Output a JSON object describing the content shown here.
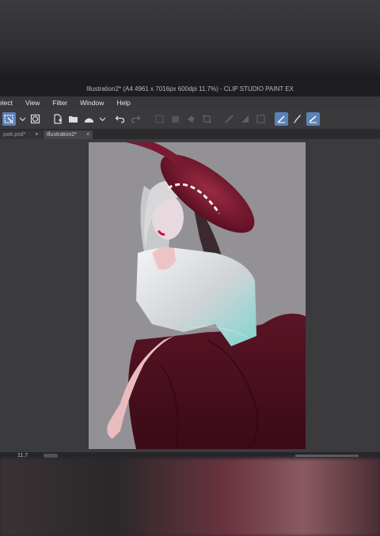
{
  "window": {
    "title": "Illustration2* (A4 4961 x 7016px 600dpi 11.7%) - CLIP STUDIO PAINT EX"
  },
  "menu": {
    "items": [
      "elect",
      "View",
      "Filter",
      "Window",
      "Help"
    ]
  },
  "tabs": [
    {
      "label": "pwk.psd*",
      "close": "×"
    },
    {
      "label": "Illustration2*",
      "close": "×"
    }
  ],
  "status": {
    "zoom": "11.7"
  },
  "toolbar": {
    "icons": [
      "select-layer-icon",
      "chevron-down-icon",
      "layer-mask-icon",
      "new-canvas-icon",
      "open-folder-icon",
      "save-icon",
      "chevron-down-icon",
      "undo-icon",
      "redo-icon",
      "clear-icon",
      "fill-icon",
      "transform-icon",
      "crop-icon",
      "ruler-icon",
      "gradient-icon",
      "border-icon",
      "pen-icon",
      "brush-icon",
      "correction-icon"
    ]
  },
  "colors": {
    "hat": "#7a1a30",
    "skirt": "#4e1020",
    "canvas": "#939196",
    "active_tool": "#5b82b8"
  }
}
